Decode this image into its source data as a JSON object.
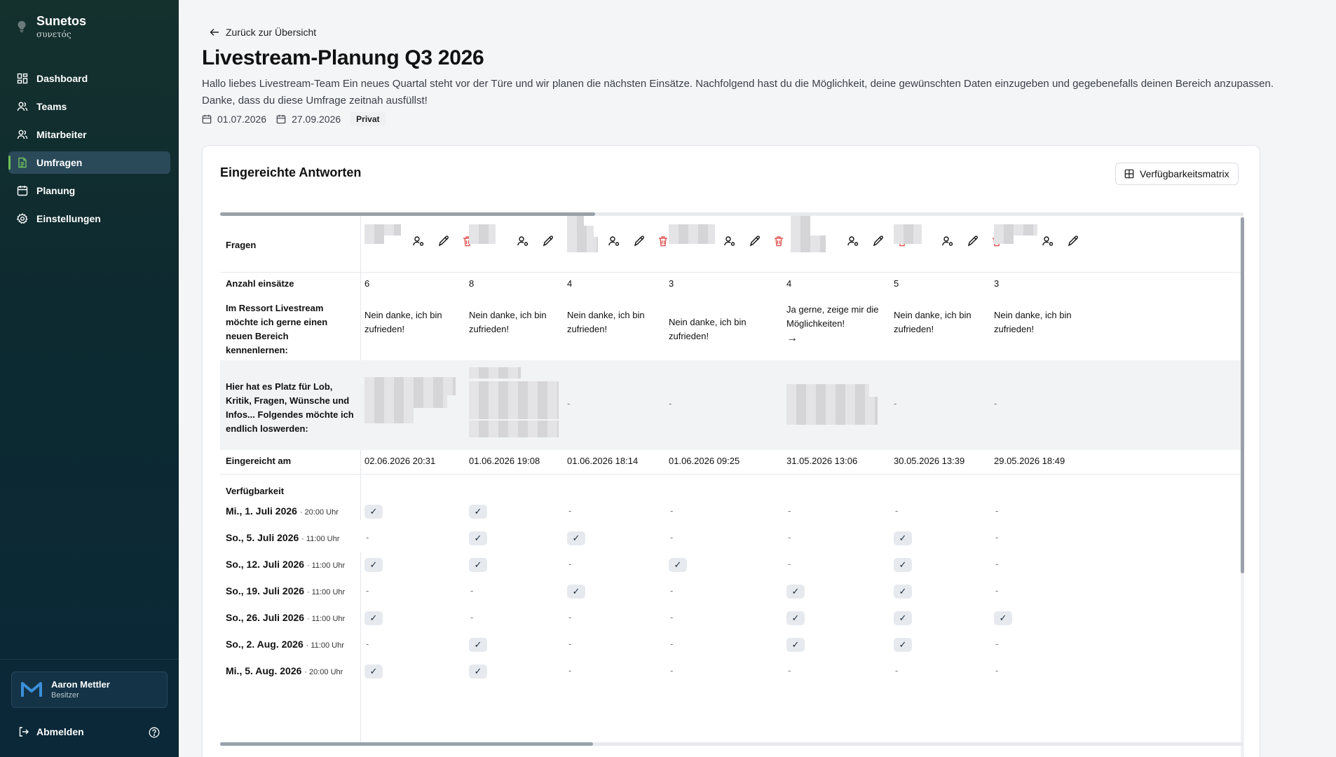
{
  "sidebar": {
    "brand": {
      "name": "Sunetos",
      "sub": "συνετός"
    },
    "nav": [
      {
        "label": "Dashboard",
        "icon": "dashboard-icon",
        "active": false
      },
      {
        "label": "Teams",
        "icon": "teams-icon",
        "active": false
      },
      {
        "label": "Mitarbeiter",
        "icon": "users-icon",
        "active": false
      },
      {
        "label": "Umfragen",
        "icon": "survey-icon",
        "active": true
      },
      {
        "label": "Planung",
        "icon": "calendar-icon",
        "active": false
      },
      {
        "label": "Einstellungen",
        "icon": "settings-icon",
        "active": false
      }
    ],
    "user": {
      "name": "Aaron Mettler",
      "role": "Besitzer"
    },
    "logout": "Abmelden",
    "colors": {
      "accent": "#6fbf5a",
      "bg": "#0d2a30"
    }
  },
  "header": {
    "back": "Zurück zur Übersicht",
    "title": "Livestream-Planung Q3 2026",
    "description": "Hallo liebes Livestream-Team Ein neues Quartal steht vor der Türe und wir planen die nächsten Einsätze. Nachfolgend hast du die Möglichkeit, deine gewünschten Daten einzugeben und gegebenefalls deinen Bereich anzupassen. Danke, dass du diese Umfrage zeitnah ausfüllst!",
    "start_date": "01.07.2026",
    "end_date": "27.09.2026",
    "badge": "Privat"
  },
  "card": {
    "title": "Eingereichte Antworten",
    "matrix_button": "Verfügbarkeitsmatrix"
  },
  "table": {
    "labels": {
      "questions": "Fragen",
      "count": "Anzahl einsätze",
      "ressort": "Im Ressort Livestream möchte ich gerne einen neuen Bereich kennenlernen:",
      "feedback": "Hier hat es Platz für Lob, Kritik, Fragen, Wünsche und Infos... Folgendes möchte ich endlich loswerden:",
      "submitted": "Eingereicht am",
      "availability": "Verfügbarkeit"
    },
    "responses": [
      {
        "count": "6",
        "ressort": "Nein danke, ich bin zufrieden!",
        "feedback": "",
        "submitted": "02.06.2026 20:31"
      },
      {
        "count": "8",
        "ressort": "Nein danke, ich bin zufrieden!",
        "feedback": "",
        "submitted": "01.06.2026 19:08"
      },
      {
        "count": "4",
        "ressort": "Nein danke, ich bin zufrieden!",
        "feedback": "-",
        "submitted": "01.06.2026 18:14"
      },
      {
        "count": "3",
        "ressort": "Nein danke, ich bin zufrieden!",
        "feedback": "-",
        "submitted": "01.06.2026 09:25"
      },
      {
        "count": "4",
        "ressort": "Ja gerne, zeige mir die Möglichkeiten!",
        "ressort_arrow": "→",
        "feedback": "",
        "submitted": "31.05.2026 13:06"
      },
      {
        "count": "5",
        "ressort": "Nein danke, ich bin zufrieden!",
        "feedback": "-",
        "submitted": "30.05.2026 13:39"
      },
      {
        "count": "3",
        "ressort": "Nein danke, ich bin zufrieden!",
        "feedback": "-",
        "submitted": "29.05.2026 18:49"
      }
    ],
    "dates": [
      {
        "date": "Mi., 1. Juli 2026",
        "time": "· 20:00 Uhr",
        "avail": [
          1,
          1,
          0,
          0,
          0,
          0,
          0
        ]
      },
      {
        "date": "So., 5. Juli 2026",
        "time": "· 11:00 Uhr",
        "avail": [
          0,
          1,
          1,
          0,
          0,
          1,
          0
        ]
      },
      {
        "date": "So., 12. Juli 2026",
        "time": "· 11:00 Uhr",
        "avail": [
          1,
          1,
          0,
          1,
          0,
          1,
          0
        ]
      },
      {
        "date": "So., 19. Juli 2026",
        "time": "· 11:00 Uhr",
        "avail": [
          0,
          0,
          1,
          0,
          1,
          1,
          0
        ]
      },
      {
        "date": "So., 26. Juli 2026",
        "time": "· 11:00 Uhr",
        "avail": [
          1,
          0,
          0,
          0,
          1,
          1,
          1
        ]
      },
      {
        "date": "So., 2. Aug. 2026",
        "time": "· 11:00 Uhr",
        "avail": [
          0,
          1,
          0,
          0,
          1,
          1,
          0
        ]
      },
      {
        "date": "Mi., 5. Aug. 2026",
        "time": "· 20:00 Uhr",
        "avail": [
          1,
          1,
          0,
          0,
          0,
          0,
          0
        ]
      }
    ],
    "check_glyph": "✓",
    "dash_glyph": "-"
  }
}
